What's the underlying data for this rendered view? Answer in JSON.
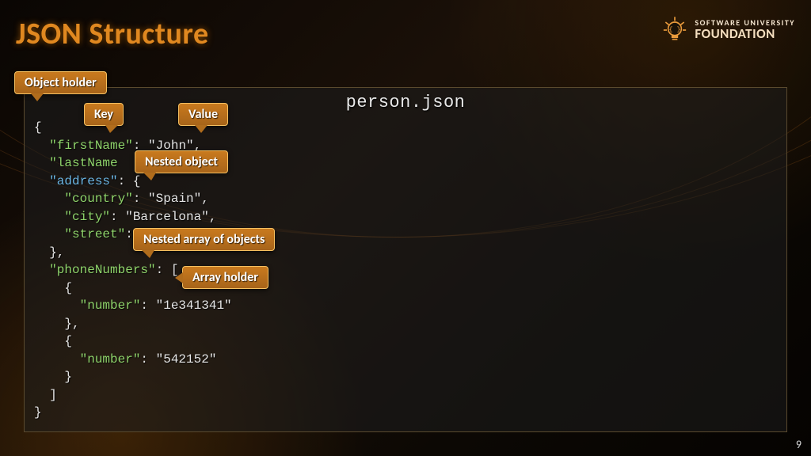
{
  "slide": {
    "title": "JSON Structure",
    "page_number": "9"
  },
  "logo": {
    "line1": "SOFTWARE UNIVERSITY",
    "line2": "FOUNDATION"
  },
  "panel": {
    "filename": "person.json"
  },
  "code": {
    "l1": "{",
    "l2a": "\"firstName\"",
    "l2b": ": ",
    "l2c": "\"John\"",
    "l2d": ",",
    "l3a": "\"lastName",
    "l4a": "\"address\"",
    "l4b": ": {",
    "l5a": "\"country\"",
    "l5b": ": ",
    "l5c": "\"Spain\"",
    "l5d": ",",
    "l6a": "\"city\"",
    "l6b": ": ",
    "l6c": "\"Barcelona\"",
    "l6d": ",",
    "l7a": "\"street\"",
    "l7b": ": \"",
    "l8": "},",
    "l9a": "\"phoneNumbers\"",
    "l9b": ": [",
    "l10": "{",
    "l11a": "\"number\"",
    "l11b": ": ",
    "l11c": "\"1e341341\"",
    "l12": "},",
    "l13": "{",
    "l14a": "\"number\"",
    "l14b": ": ",
    "l14c": "\"542152\"",
    "l15": "}",
    "l16": "]",
    "l17": "}"
  },
  "callouts": {
    "object_holder": "Object holder",
    "key": "Key",
    "value": "Value",
    "nested_object": "Nested object",
    "nested_array": "Nested array of objects",
    "array_holder": "Array holder"
  }
}
